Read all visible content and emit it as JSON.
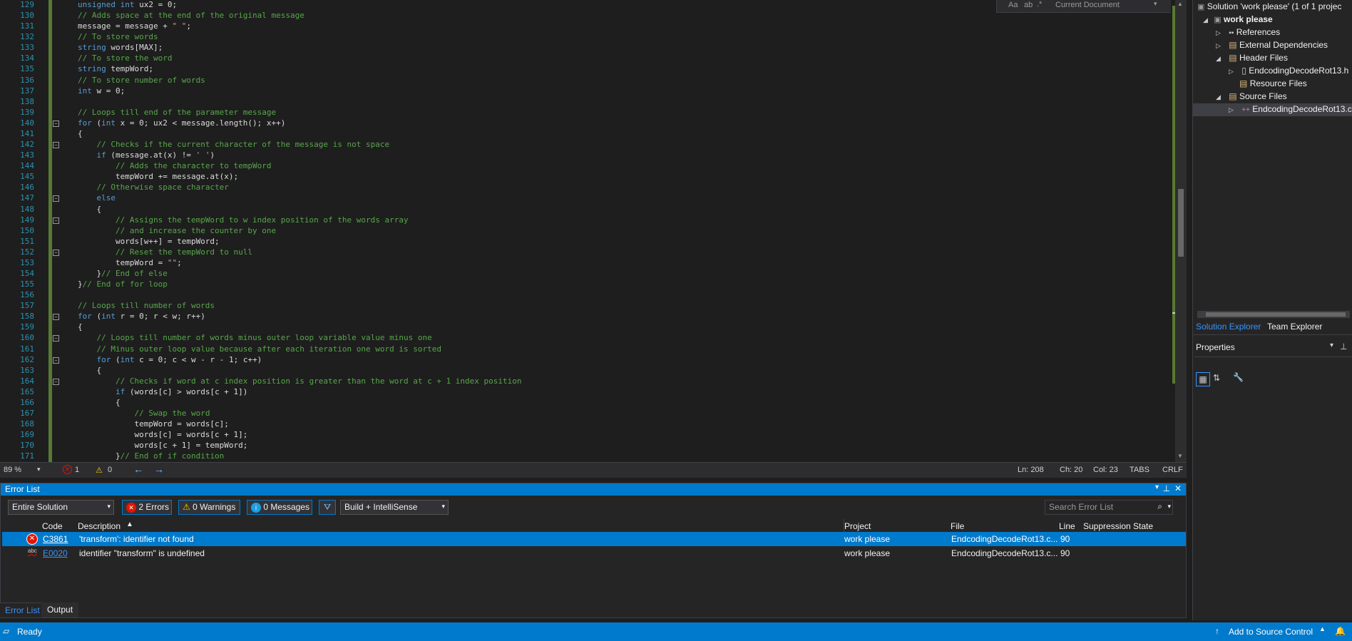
{
  "editor": {
    "lines": [
      {
        "n": "129",
        "html": "<span class=\"k\">unsigned int</span> ux2 = 0;"
      },
      {
        "n": "130",
        "html": "<span class=\"c\">// Adds space at the end of the original message</span>"
      },
      {
        "n": "131",
        "html": "message = message + <span class=\"s\">\" \"</span>;"
      },
      {
        "n": "132",
        "html": "<span class=\"c\">// To store words</span>"
      },
      {
        "n": "133",
        "html": "<span class=\"k\">string</span> words[MAX];"
      },
      {
        "n": "134",
        "html": "<span class=\"c\">// To store the word</span>"
      },
      {
        "n": "135",
        "html": "<span class=\"k\">string</span> tempWord;"
      },
      {
        "n": "136",
        "html": "<span class=\"c\">// To store number of words</span>"
      },
      {
        "n": "137",
        "html": "<span class=\"k\">int</span> w = 0;"
      },
      {
        "n": "138",
        "html": ""
      },
      {
        "n": "139",
        "html": "<span class=\"c\">// Loops till end of the parameter message</span>"
      },
      {
        "n": "140",
        "html": "<span class=\"k\">for</span> (<span class=\"k\">int</span> x = 0; ux2 &lt; message.length(); x++)"
      },
      {
        "n": "141",
        "html": "{"
      },
      {
        "n": "142",
        "html": "    <span class=\"c\">// Checks if the current character of the message is not space</span>"
      },
      {
        "n": "143",
        "html": "    <span class=\"k\">if</span> (message.at(x) != <span class=\"s\">' '</span>)"
      },
      {
        "n": "144",
        "html": "        <span class=\"c\">// Adds the character to tempWord</span>"
      },
      {
        "n": "145",
        "html": "        tempWord += message.at(x);"
      },
      {
        "n": "146",
        "html": "    <span class=\"c\">// Otherwise space character</span>"
      },
      {
        "n": "147",
        "html": "    <span class=\"k\">else</span>"
      },
      {
        "n": "148",
        "html": "    {"
      },
      {
        "n": "149",
        "html": "        <span class=\"c\">// Assigns the tempWord to w index position of the words array</span>"
      },
      {
        "n": "150",
        "html": "        <span class=\"c\">// and increase the counter by one</span>"
      },
      {
        "n": "151",
        "html": "        words[w++] = tempWord;"
      },
      {
        "n": "152",
        "html": "        <span class=\"c\">// Reset the tempWord to null</span>"
      },
      {
        "n": "153",
        "html": "        tempWord = <span class=\"s\">\"\"</span>;"
      },
      {
        "n": "154",
        "html": "    }<span class=\"c\">// End of else</span>"
      },
      {
        "n": "155",
        "html": "}<span class=\"c\">// End of for loop</span>"
      },
      {
        "n": "156",
        "html": ""
      },
      {
        "n": "157",
        "html": "<span class=\"c\">// Loops till number of words</span>"
      },
      {
        "n": "158",
        "html": "<span class=\"k\">for</span> (<span class=\"k\">int</span> r = 0; r &lt; w; r++)"
      },
      {
        "n": "159",
        "html": "{"
      },
      {
        "n": "160",
        "html": "    <span class=\"c\">// Loops till number of words minus outer loop variable value minus one</span>"
      },
      {
        "n": "161",
        "html": "    <span class=\"c\">// Minus outer loop value because after each iteration one word is sorted</span>"
      },
      {
        "n": "162",
        "html": "    <span class=\"k\">for</span> (<span class=\"k\">int</span> c = 0; c &lt; w - r - 1; c++)"
      },
      {
        "n": "163",
        "html": "    {"
      },
      {
        "n": "164",
        "html": "        <span class=\"c\">// Checks if word at c index position is greater than the word at c + 1 index position</span>"
      },
      {
        "n": "165",
        "html": "        <span class=\"k\">if</span> (words[c] &gt; words[c + 1])"
      },
      {
        "n": "166",
        "html": "        {"
      },
      {
        "n": "167",
        "html": "            <span class=\"c\">// Swap the word</span>"
      },
      {
        "n": "168",
        "html": "            tempWord = words[c];"
      },
      {
        "n": "169",
        "html": "            words[c] = words[c + 1];"
      },
      {
        "n": "170",
        "html": "            words[c + 1] = tempWord;"
      },
      {
        "n": "171",
        "html": "        }<span class=\"c\">// End of if condition</span>"
      }
    ],
    "fold_lines": [
      "140",
      "142",
      "147",
      "149",
      "152",
      "158",
      "160",
      "162",
      "164"
    ],
    "find_scope": "Current Document"
  },
  "editor_status": {
    "zoom": "89 %",
    "errors": "1",
    "warnings": "0",
    "ln": "Ln: 208",
    "ch": "Ch: 20",
    "col": "Col: 23",
    "tabs": "TABS",
    "eol": "CRLF"
  },
  "error_list": {
    "title": "Error List",
    "scope": "Entire Solution",
    "errors_btn": "2 Errors",
    "warnings_btn": "0 Warnings",
    "messages_btn": "0 Messages",
    "build_filter": "Build + IntelliSense",
    "search_placeholder": "Search Error List",
    "columns": {
      "code": "Code",
      "description": "Description",
      "project": "Project",
      "file": "File",
      "line": "Line",
      "suppression": "Suppression State"
    },
    "rows": [
      {
        "code": "C3861",
        "description": "'transform': identifier not found",
        "project": "work please",
        "file": "EndcodingDecodeRot13.c...",
        "line": "90"
      },
      {
        "code": "E0020",
        "description": "identifier \"transform\" is undefined",
        "project": "work please",
        "file": "EndcodingDecodeRot13.c...",
        "line": "90"
      }
    ]
  },
  "bottom_tabs": {
    "error_list": "Error List",
    "output": "Output"
  },
  "solution_explorer": {
    "solution": "Solution 'work please' (1 of 1 projec",
    "project": "work please",
    "references": "References",
    "external": "External Dependencies",
    "header_files": "Header Files",
    "header_file": "EndcodingDecodeRot13.h",
    "resource_files": "Resource Files",
    "source_files": "Source Files",
    "source_file": "EndcodingDecodeRot13.c",
    "tab_solution": "Solution Explorer",
    "tab_team": "Team Explorer"
  },
  "properties": {
    "title": "Properties"
  },
  "status_bar": {
    "ready": "Ready",
    "source_control": "Add to Source Control"
  },
  "colors": {
    "accent": "#007acc",
    "error": "#e51400",
    "warning": "#ffcc00",
    "comment": "#57a64a",
    "keyword": "#569cd6"
  }
}
